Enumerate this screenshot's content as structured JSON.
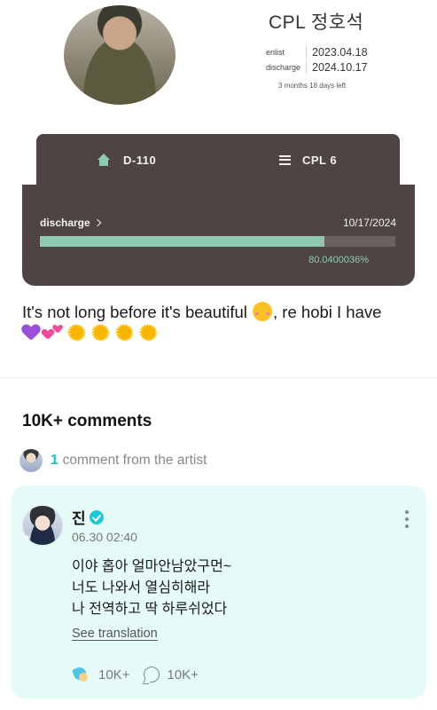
{
  "profile": {
    "rank_name": "CPL 정호석",
    "enlist_label": "enlist",
    "enlist_date": "2023.04.18",
    "discharge_label": "discharge",
    "discharge_date": "2024.10.17",
    "time_left": "3 months 18 days left"
  },
  "dday_card": {
    "tabs": [
      {
        "label": "D-110",
        "icon": "home-icon"
      },
      {
        "label": "CPL 6",
        "icon": "menu-icon"
      }
    ],
    "discharge_link": "discharge",
    "discharge_date": "10/17/2024",
    "progress_percent": 80.0400036,
    "progress_text": "80.0400036%",
    "colors": {
      "card_bg": "#4e4543",
      "accent": "#8fcab0"
    }
  },
  "post": {
    "text_part1": "It's not long before it's beautiful ",
    "text_part2": ", re hobi I have",
    "emojis": [
      "smiling-face-with-hearts",
      "purple-heart",
      "two-hearts",
      "sun",
      "sun",
      "sun",
      "sun"
    ]
  },
  "comments": {
    "count_title": "10K+ comments",
    "artist_count": "1",
    "artist_text": "comment from the artist",
    "items": [
      {
        "author": "진",
        "time": "06.30 02:40",
        "lines": [
          "이야 홉아 얼마안남았구먼~",
          "너도 나와서 열심히해라",
          "나 전역하고 딱 하루쉬었다"
        ],
        "see_translation": "See translation",
        "likes": "10K+",
        "replies": "10K+",
        "card_color": "#e6fbf7"
      }
    ]
  }
}
